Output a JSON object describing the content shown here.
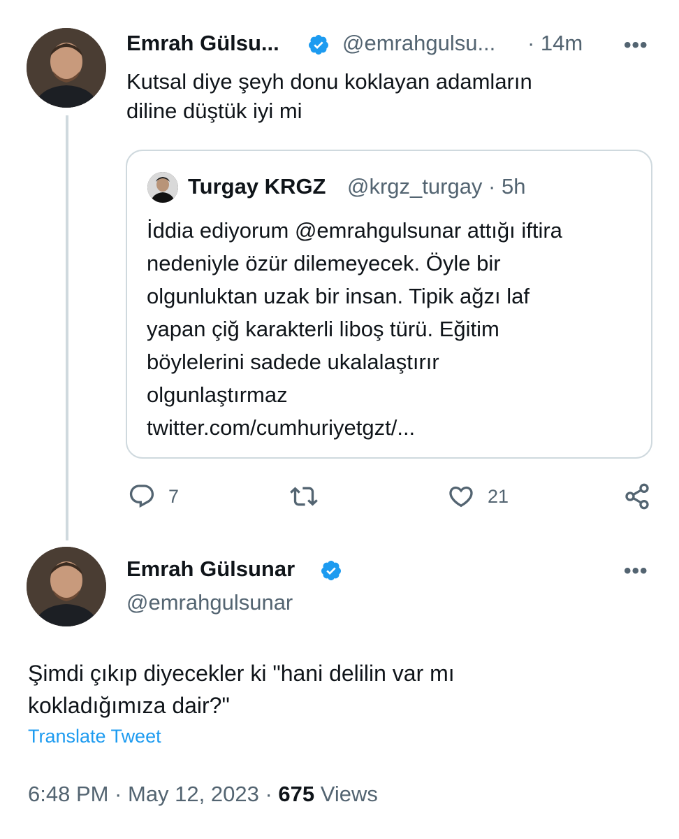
{
  "quoted_tweet": {
    "author_name": "Emrah Gülsu...",
    "author_handle": "@emrahgulsu...",
    "time": "· 14m",
    "more_label": "•••",
    "text": "Kutsal diye şeyh donu koklayan adamların\ndiline düştük iyi mi",
    "quote": {
      "author_name": "Turgay KRGZ",
      "author_handle": "@krgz_turgay · 5h",
      "text": "İddia ediyorum @emrahgulsunar attığı iftira\nnedeniyle özür dilemeyecek. Öyle bir\nolgunluktan uzak bir insan. Tipik ağzı laf\nyapan çiğ karakterli liboş türü. Eğitim\nböylelerini sadede ukalalaştırır\nolgunlaştırmaz\ntwitter.com/cumhuriyetgzt/..."
    },
    "actions": {
      "reply_count": "7",
      "retweet_count": "",
      "like_count": "21"
    }
  },
  "main_tweet": {
    "author_name": "Emrah Gülsunar",
    "author_handle": "@emrahgulsunar",
    "more_label": "•••",
    "text": "Şimdi çıkıp diyecekler ki \"hani delilin var mı\nkokladığımıza dair?\"",
    "translate_label": "Translate Tweet",
    "time": "6:48 PM · May 12, 2023 ·",
    "views_count": "675",
    "views_label": "Views"
  },
  "colors": {
    "verified_blue": "#1d9bf0",
    "secondary_text": "#536471",
    "border": "#cfd9de"
  },
  "icons": [
    "verified-badge-icon",
    "more-icon",
    "reply-icon",
    "retweet-icon",
    "like-icon",
    "share-icon"
  ]
}
